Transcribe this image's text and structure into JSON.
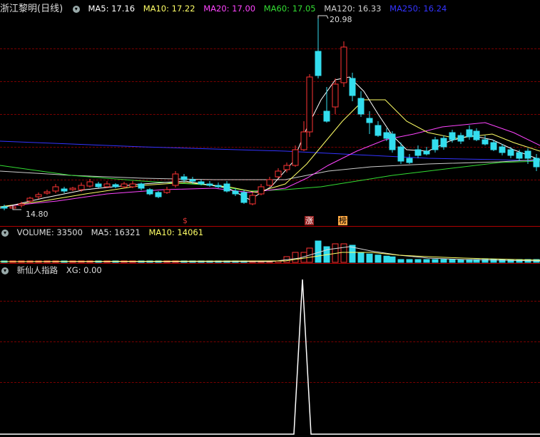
{
  "main": {
    "title": "浙江黎明(日线)",
    "ma": [
      {
        "label": "MA5: 17.16",
        "color": "#ffffff"
      },
      {
        "label": "MA10: 17.22",
        "color": "#ffff66"
      },
      {
        "label": "MA20: 17.00",
        "color": "#ff44ff"
      },
      {
        "label": "MA60: 17.05",
        "color": "#33dd33"
      },
      {
        "label": "MA120: 16.33",
        "color": "#cccccc"
      },
      {
        "label": "MA250: 16.24",
        "color": "#3333ff"
      }
    ],
    "high_label": "20.98",
    "low_label": "14.80",
    "markers": [
      {
        "text": "$",
        "color": "#dd3333"
      },
      {
        "text": "涨",
        "color": "#ff8888"
      },
      {
        "text": "榜",
        "color": "#ffcc66"
      }
    ]
  },
  "volume": {
    "labels": [
      {
        "text": "VOLUME: 33500",
        "color": "#dddddd"
      },
      {
        "text": "MA5: 16321",
        "color": "#dddddd"
      },
      {
        "text": "MA10: 14061",
        "color": "#ffff66"
      }
    ]
  },
  "indicator": {
    "name": "新仙人指路",
    "value": "XG: 0.00"
  },
  "colors": {
    "up": "#ff3333",
    "down": "#33ddee",
    "grid": "#7a0000",
    "sep": "#b00000"
  }
}
